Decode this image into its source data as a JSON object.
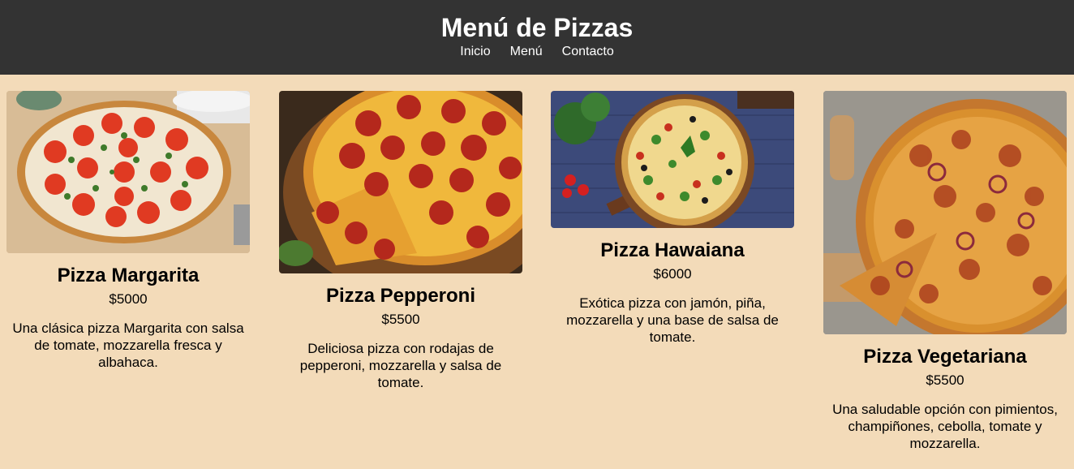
{
  "header": {
    "title": "Menú de Pizzas",
    "nav": [
      "Inicio",
      "Menú",
      "Contacto"
    ]
  },
  "pizzas": [
    {
      "name": "Pizza Margarita",
      "price": "$5000",
      "description": "Una clásica pizza Margarita con salsa de tomate, mozzarella fresca y albahaca."
    },
    {
      "name": "Pizza Pepperoni",
      "price": "$5500",
      "description": "Deliciosa pizza con rodajas de pepperoni, mozzarella y salsa de tomate."
    },
    {
      "name": "Pizza Hawaiana",
      "price": "$6000",
      "description": "Exótica pizza con jamón, piña, mozzarella y una base de salsa de tomate."
    },
    {
      "name": "Pizza Vegetariana",
      "price": "$5500",
      "description": "Una saludable opción con pimientos, champiñones, cebolla, tomate y mozzarella."
    }
  ],
  "colors": {
    "header_bg": "#333333",
    "page_bg": "#f3dbb9"
  }
}
